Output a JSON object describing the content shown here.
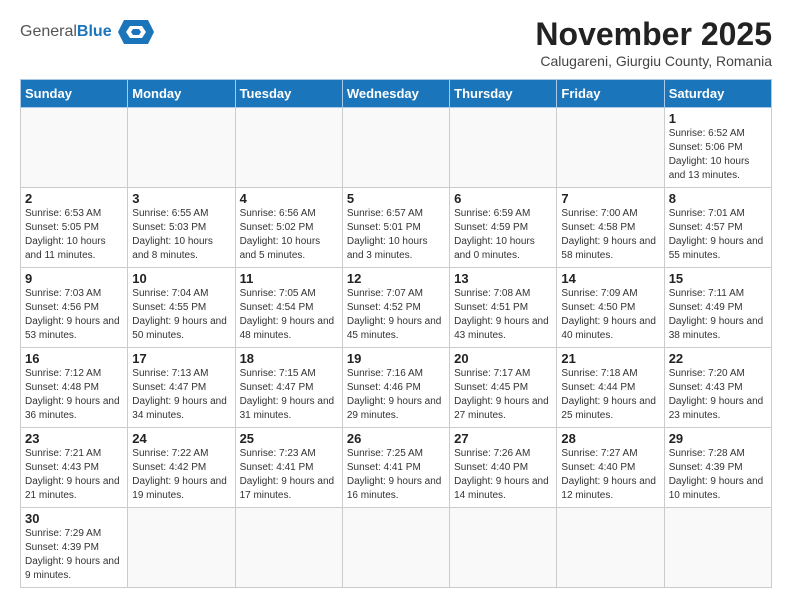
{
  "header": {
    "logo_general": "General",
    "logo_blue": "Blue",
    "month_title": "November 2025",
    "subtitle": "Calugareni, Giurgiu County, Romania"
  },
  "weekdays": [
    "Sunday",
    "Monday",
    "Tuesday",
    "Wednesday",
    "Thursday",
    "Friday",
    "Saturday"
  ],
  "weeks": [
    [
      {
        "day": "",
        "info": ""
      },
      {
        "day": "",
        "info": ""
      },
      {
        "day": "",
        "info": ""
      },
      {
        "day": "",
        "info": ""
      },
      {
        "day": "",
        "info": ""
      },
      {
        "day": "",
        "info": ""
      },
      {
        "day": "1",
        "info": "Sunrise: 6:52 AM\nSunset: 5:06 PM\nDaylight: 10 hours and 13 minutes."
      }
    ],
    [
      {
        "day": "2",
        "info": "Sunrise: 6:53 AM\nSunset: 5:05 PM\nDaylight: 10 hours and 11 minutes."
      },
      {
        "day": "3",
        "info": "Sunrise: 6:55 AM\nSunset: 5:03 PM\nDaylight: 10 hours and 8 minutes."
      },
      {
        "day": "4",
        "info": "Sunrise: 6:56 AM\nSunset: 5:02 PM\nDaylight: 10 hours and 5 minutes."
      },
      {
        "day": "5",
        "info": "Sunrise: 6:57 AM\nSunset: 5:01 PM\nDaylight: 10 hours and 3 minutes."
      },
      {
        "day": "6",
        "info": "Sunrise: 6:59 AM\nSunset: 4:59 PM\nDaylight: 10 hours and 0 minutes."
      },
      {
        "day": "7",
        "info": "Sunrise: 7:00 AM\nSunset: 4:58 PM\nDaylight: 9 hours and 58 minutes."
      },
      {
        "day": "8",
        "info": "Sunrise: 7:01 AM\nSunset: 4:57 PM\nDaylight: 9 hours and 55 minutes."
      }
    ],
    [
      {
        "day": "9",
        "info": "Sunrise: 7:03 AM\nSunset: 4:56 PM\nDaylight: 9 hours and 53 minutes."
      },
      {
        "day": "10",
        "info": "Sunrise: 7:04 AM\nSunset: 4:55 PM\nDaylight: 9 hours and 50 minutes."
      },
      {
        "day": "11",
        "info": "Sunrise: 7:05 AM\nSunset: 4:54 PM\nDaylight: 9 hours and 48 minutes."
      },
      {
        "day": "12",
        "info": "Sunrise: 7:07 AM\nSunset: 4:52 PM\nDaylight: 9 hours and 45 minutes."
      },
      {
        "day": "13",
        "info": "Sunrise: 7:08 AM\nSunset: 4:51 PM\nDaylight: 9 hours and 43 minutes."
      },
      {
        "day": "14",
        "info": "Sunrise: 7:09 AM\nSunset: 4:50 PM\nDaylight: 9 hours and 40 minutes."
      },
      {
        "day": "15",
        "info": "Sunrise: 7:11 AM\nSunset: 4:49 PM\nDaylight: 9 hours and 38 minutes."
      }
    ],
    [
      {
        "day": "16",
        "info": "Sunrise: 7:12 AM\nSunset: 4:48 PM\nDaylight: 9 hours and 36 minutes."
      },
      {
        "day": "17",
        "info": "Sunrise: 7:13 AM\nSunset: 4:47 PM\nDaylight: 9 hours and 34 minutes."
      },
      {
        "day": "18",
        "info": "Sunrise: 7:15 AM\nSunset: 4:47 PM\nDaylight: 9 hours and 31 minutes."
      },
      {
        "day": "19",
        "info": "Sunrise: 7:16 AM\nSunset: 4:46 PM\nDaylight: 9 hours and 29 minutes."
      },
      {
        "day": "20",
        "info": "Sunrise: 7:17 AM\nSunset: 4:45 PM\nDaylight: 9 hours and 27 minutes."
      },
      {
        "day": "21",
        "info": "Sunrise: 7:18 AM\nSunset: 4:44 PM\nDaylight: 9 hours and 25 minutes."
      },
      {
        "day": "22",
        "info": "Sunrise: 7:20 AM\nSunset: 4:43 PM\nDaylight: 9 hours and 23 minutes."
      }
    ],
    [
      {
        "day": "23",
        "info": "Sunrise: 7:21 AM\nSunset: 4:43 PM\nDaylight: 9 hours and 21 minutes."
      },
      {
        "day": "24",
        "info": "Sunrise: 7:22 AM\nSunset: 4:42 PM\nDaylight: 9 hours and 19 minutes."
      },
      {
        "day": "25",
        "info": "Sunrise: 7:23 AM\nSunset: 4:41 PM\nDaylight: 9 hours and 17 minutes."
      },
      {
        "day": "26",
        "info": "Sunrise: 7:25 AM\nSunset: 4:41 PM\nDaylight: 9 hours and 16 minutes."
      },
      {
        "day": "27",
        "info": "Sunrise: 7:26 AM\nSunset: 4:40 PM\nDaylight: 9 hours and 14 minutes."
      },
      {
        "day": "28",
        "info": "Sunrise: 7:27 AM\nSunset: 4:40 PM\nDaylight: 9 hours and 12 minutes."
      },
      {
        "day": "29",
        "info": "Sunrise: 7:28 AM\nSunset: 4:39 PM\nDaylight: 9 hours and 10 minutes."
      }
    ],
    [
      {
        "day": "30",
        "info": "Sunrise: 7:29 AM\nSunset: 4:39 PM\nDaylight: 9 hours and 9 minutes."
      },
      {
        "day": "",
        "info": ""
      },
      {
        "day": "",
        "info": ""
      },
      {
        "day": "",
        "info": ""
      },
      {
        "day": "",
        "info": ""
      },
      {
        "day": "",
        "info": ""
      },
      {
        "day": "",
        "info": ""
      }
    ]
  ]
}
